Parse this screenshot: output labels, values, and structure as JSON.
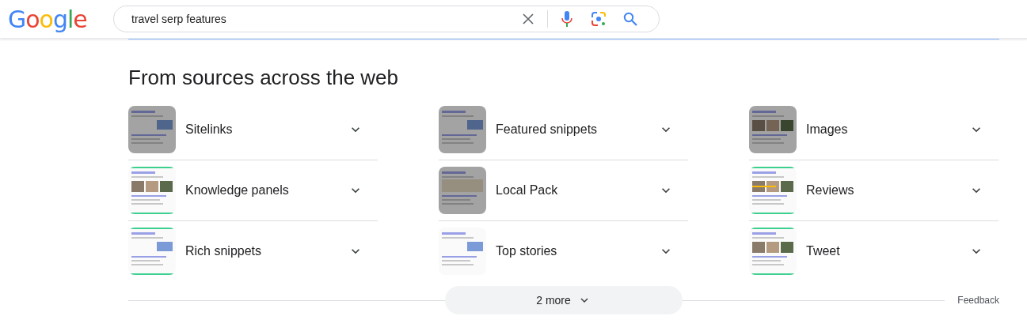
{
  "header": {
    "logo": "Google",
    "search": {
      "value": "travel serp features"
    }
  },
  "section": {
    "title": "From sources across the web",
    "items": [
      {
        "label": "Sitelinks",
        "dimmed": true
      },
      {
        "label": "Featured snippets",
        "dimmed": true
      },
      {
        "label": "Images",
        "dimmed": true
      },
      {
        "label": "Knowledge panels",
        "dimmed": false
      },
      {
        "label": "Local Pack",
        "dimmed": true
      },
      {
        "label": "Reviews",
        "dimmed": false
      },
      {
        "label": "Rich snippets",
        "dimmed": false
      },
      {
        "label": "Top stories",
        "dimmed": false
      },
      {
        "label": "Tweet",
        "dimmed": false
      }
    ],
    "more_button": "2 more",
    "feedback": "Feedback"
  }
}
